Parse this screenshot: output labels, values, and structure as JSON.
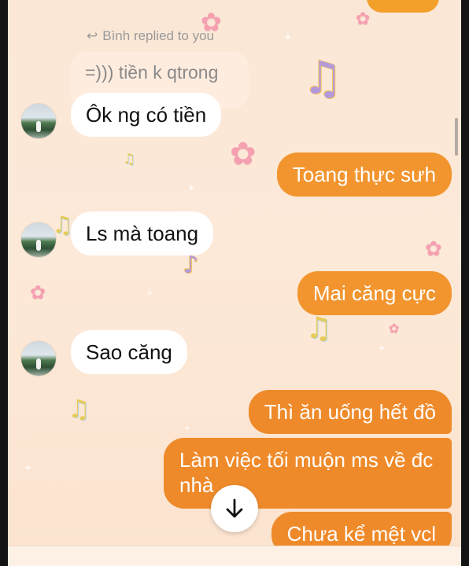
{
  "conversation": {
    "reply_context": {
      "label": "Bình replied to you",
      "quoted_text": "=))) tiền k qtrong"
    },
    "messages": [
      {
        "direction": "incoming",
        "text": "Ôk ng có tiền"
      },
      {
        "direction": "outgoing",
        "text": "Toang thực sưh"
      },
      {
        "direction": "incoming",
        "text": "Ls mà toang"
      },
      {
        "direction": "outgoing",
        "text": "Mai căng cực"
      },
      {
        "direction": "incoming",
        "text": "Sao căng"
      },
      {
        "direction": "outgoing",
        "text": "Thì ăn uống hết đồ"
      },
      {
        "direction": "outgoing",
        "text": "Làm việc tối muộn ms về đc nhà"
      },
      {
        "direction": "outgoing",
        "text": "Chưa kể mệt vcl"
      }
    ]
  },
  "controls": {
    "scroll_down_icon": "arrow-down-icon"
  },
  "icons": {
    "reply": "reply-arrow-icon",
    "flower": "flower-icon",
    "music_note": "music-note-icon"
  },
  "colors": {
    "outgoing_bubble": "#f2952f",
    "incoming_bubble": "#ffffff",
    "background": "#fde9d8"
  }
}
